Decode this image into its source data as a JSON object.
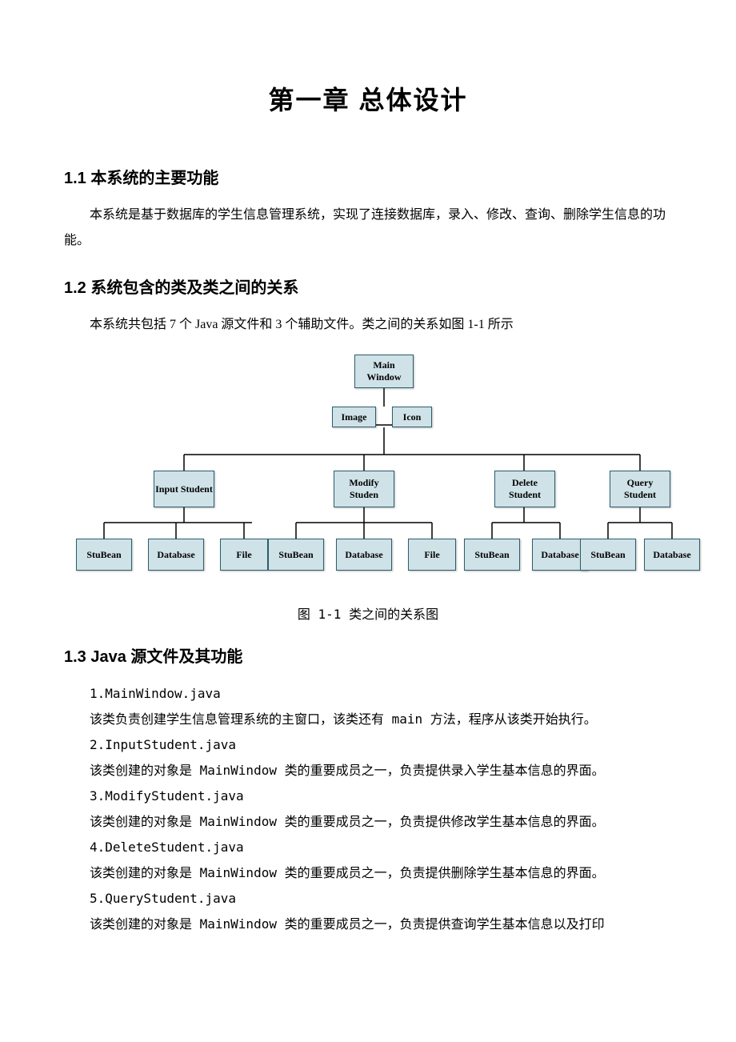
{
  "title": "第一章  总体设计",
  "section1": {
    "heading": "1.1 本系统的主要功能",
    "para": "本系统是基于数据库的学生信息管理系统，实现了连接数据库，录入、修改、查询、删除学生信息的功能。"
  },
  "section2": {
    "heading": "1.2 系统包含的类及类之间的关系",
    "para": "本系统共包括 7 个 Java 源文件和 3 个辅助文件。类之间的关系如图 1-1 所示"
  },
  "figure_caption": "图 1-1 类之间的关系图",
  "diagram_nodes": {
    "root": "Main Window",
    "image": "Image",
    "icon": "Icon",
    "input": "Input Student",
    "modify": "Modify Studen",
    "delete": "Delete Student",
    "query": "Query Student",
    "stubean": "StuBean",
    "database": "Database",
    "file": "File"
  },
  "section3": {
    "heading": "1.3  Java 源文件及其功能",
    "items": [
      "1.MainWindow.java",
      "该类负责创建学生信息管理系统的主窗口，该类还有 main 方法，程序从该类开始执行。",
      "2.InputStudent.java",
      "该类创建的对象是 MainWindow 类的重要成员之一，负责提供录入学生基本信息的界面。",
      "3.ModifyStudent.java",
      "该类创建的对象是 MainWindow 类的重要成员之一，负责提供修改学生基本信息的界面。",
      "4.DeleteStudent.java",
      "该类创建的对象是 MainWindow 类的重要成员之一，负责提供删除学生基本信息的界面。",
      "5.QueryStudent.java",
      "该类创建的对象是 MainWindow 类的重要成员之一，负责提供查询学生基本信息以及打印"
    ]
  }
}
